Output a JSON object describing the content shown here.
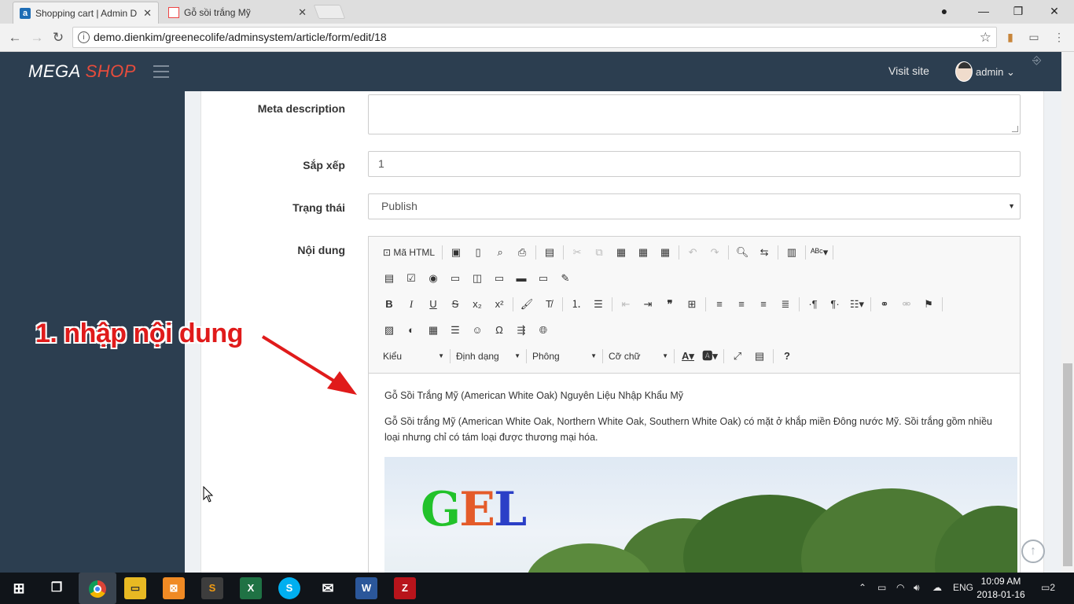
{
  "browser": {
    "tabs": [
      {
        "title": "Shopping cart | Admin D",
        "active": true
      },
      {
        "title": "Gỗ sồi trắng Mỹ",
        "active": false
      }
    ],
    "url": "demo.dienkim/greenecolife/adminsystem/article/form/edit/18"
  },
  "app": {
    "brand_main": "MEGA",
    "brand_accent": "SHOP",
    "visit_site": "Visit site",
    "user": "admin",
    "accent_color": "#e74c3c",
    "nav_color": "#2c3e50"
  },
  "form": {
    "meta_description_label": "Meta description",
    "meta_description_value": "",
    "sort_label": "Sắp xếp",
    "sort_value": "1",
    "status_label": "Trạng thái",
    "status_value": "Publish",
    "content_label": "Nội dung"
  },
  "editor": {
    "source_button": "Mã HTML",
    "combo_style": "Kiểu",
    "combo_format": "Định dạng",
    "combo_font": "Phông",
    "combo_size": "Cỡ chữ",
    "content_title": "Gỗ Sồi Trắng Mỹ (American White Oak) Nguyên Liệu Nhập Khẩu Mỹ",
    "content_paragraph": "Gỗ Sồi trắng Mỹ (American White Oak, Northern White Oak, Southern White Oak) có mặt ở khắp miền Đông nước Mỹ. Sồi trắng gồm nhiều loại nhưng chỉ có tám loại được thương mại hóa.",
    "image_logo": "GEL"
  },
  "annotation": {
    "text": "1. nhập nội dung",
    "color": "#e01b1b"
  },
  "taskbar": {
    "language": "ENG",
    "time": "10:09 AM",
    "date": "2018-01-16",
    "notification_count": "2"
  }
}
